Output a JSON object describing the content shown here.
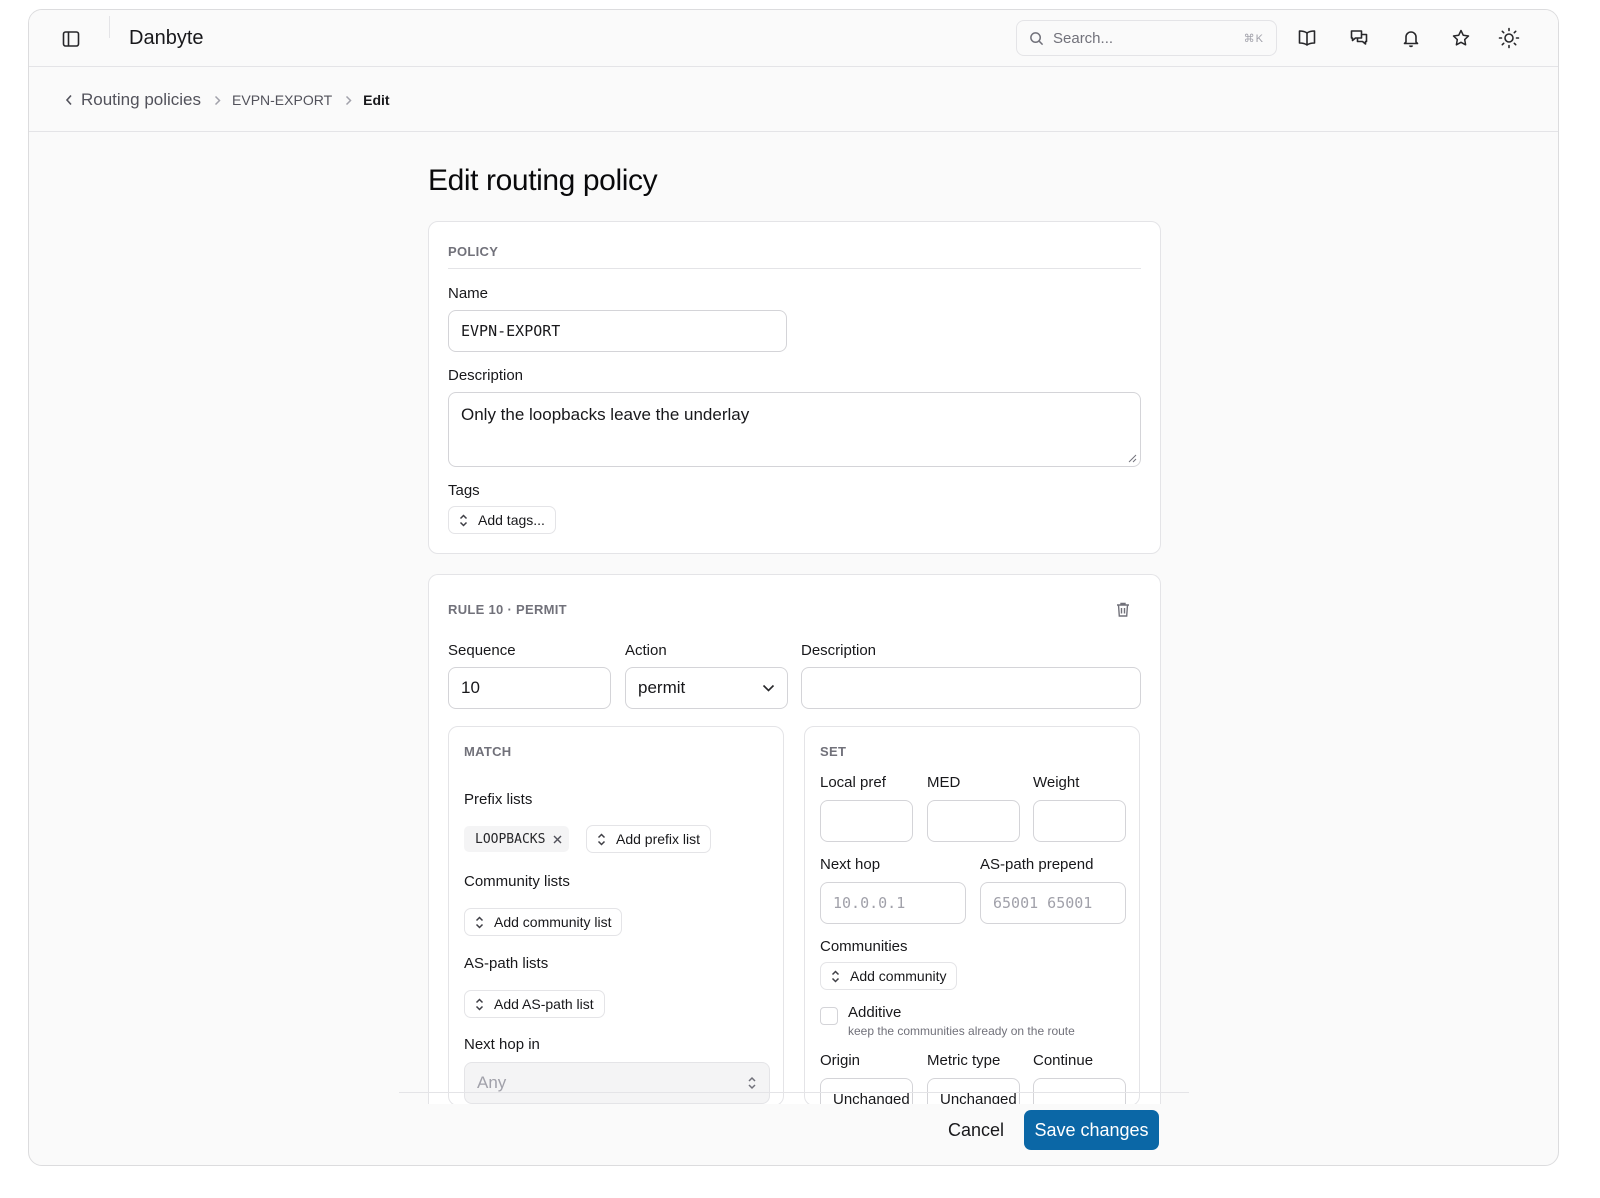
{
  "app": {
    "title": "Danbyte"
  },
  "search": {
    "placeholder": "Search...",
    "shortcut": "⌘K"
  },
  "header_icons": [
    "book-icon",
    "chat-icon",
    "bell-icon",
    "star-icon",
    "sun-icon"
  ],
  "breadcrumb": {
    "back": "Routing policies",
    "item": "EVPN-EXPORT",
    "current": "Edit"
  },
  "page": {
    "title": "Edit routing policy"
  },
  "policy": {
    "section": "POLICY",
    "name_label": "Name",
    "name_value": "EVPN-EXPORT",
    "description_label": "Description",
    "description_value": "Only the loopbacks leave the underlay",
    "tags_label": "Tags",
    "add_tags": "Add tags..."
  },
  "rule": {
    "section": "RULE 10 · PERMIT",
    "sequence_label": "Sequence",
    "sequence_value": "10",
    "action_label": "Action",
    "action_value": "permit",
    "description_label": "Description",
    "description_value": "",
    "match": {
      "section": "MATCH",
      "prefix_lists_label": "Prefix lists",
      "prefix_tag": "LOOPBACKS",
      "add_prefix_list": "Add prefix list",
      "community_lists_label": "Community lists",
      "add_community_list": "Add community list",
      "as_path_lists_label": "AS-path lists",
      "add_as_path_list": "Add AS-path list",
      "next_hop_in_label": "Next hop in",
      "next_hop_in_value": "Any"
    },
    "set": {
      "section": "SET",
      "local_pref_label": "Local pref",
      "med_label": "MED",
      "weight_label": "Weight",
      "next_hop_label": "Next hop",
      "next_hop_placeholder": "10.0.0.1",
      "as_path_prepend_label": "AS-path prepend",
      "as_path_prepend_placeholder": "65001 65001",
      "communities_label": "Communities",
      "add_community": "Add community",
      "additive_label": "Additive",
      "additive_help": "keep the communities already on the route",
      "origin_label": "Origin",
      "metric_type_label": "Metric type",
      "continue_label": "Continue",
      "origin_value": "Unchanged",
      "metric_type_value": "Unchanged"
    }
  },
  "footer": {
    "cancel": "Cancel",
    "save": "Save changes"
  },
  "colors": {
    "primary": "#0b67a6",
    "border": "#e4e4e7",
    "muted_text": "#71717a"
  }
}
